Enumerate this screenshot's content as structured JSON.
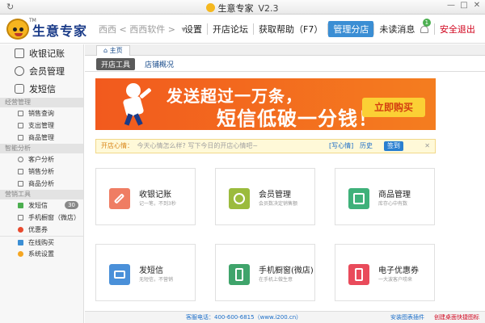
{
  "window": {
    "title": "生意专家",
    "version": "V2.3",
    "refresh_icon": "↻",
    "minimize": "—",
    "maximize": "□",
    "close": "✕"
  },
  "header": {
    "logo_text": "生意专家",
    "logo_tm": "TM",
    "company": "西西 < 西西软件 >",
    "company_arrow": "▾",
    "nav": [
      "设置",
      "开店论坛",
      "获取帮助（F7）",
      "管理分店",
      "未读消息",
      "安全退出"
    ],
    "unread_count": "1"
  },
  "sidebar": {
    "main_items": [
      "收银记账",
      "会员管理",
      "发短信"
    ],
    "sections": [
      {
        "title": "经营管理",
        "items": [
          "销售查询",
          "支出管理",
          "商品管理"
        ]
      },
      {
        "title": "智能分析",
        "items": [
          "客户分析",
          "销售分析",
          "商品分析"
        ]
      },
      {
        "title": "营销工具",
        "items": [
          "发短信",
          "手机橱窗（微店）",
          "优惠券"
        ]
      }
    ],
    "sms_count": "30",
    "bottom_items": [
      "在线购买",
      "系统设置"
    ]
  },
  "tabs": {
    "home": "主页",
    "sub": [
      "开店工具",
      "店铺概况"
    ]
  },
  "banner": {
    "line1": "发送超过一万条，",
    "line2": "短信低破一分钱！",
    "button": "立即购买"
  },
  "notice": {
    "label": "开店心情：",
    "placeholder": "今天心情怎么样? 写下今日的开店心情吧~",
    "write": "[写心情]",
    "history": "历史",
    "signin": "签到",
    "close": "✕"
  },
  "cards": [
    {
      "title": "收银记账",
      "subtitle": "记一笔，不到3秒",
      "icon": "pencil-icon",
      "color": "#ef7d63"
    },
    {
      "title": "会员管理",
      "subtitle": "会员数决定销售额",
      "icon": "members-icon",
      "color": "#9bbb3d"
    },
    {
      "title": "商品管理",
      "subtitle": "库存心中有数",
      "icon": "goods-icon",
      "color": "#3fb17a"
    },
    {
      "title": "发短信",
      "subtitle": "无短信，不营销",
      "icon": "message-icon",
      "color": "#4a90d9"
    },
    {
      "title": "手机橱窗(微店)",
      "subtitle": "在手机上做生意",
      "icon": "phone-icon",
      "color": "#3fa46b"
    },
    {
      "title": "电子优惠券",
      "subtitle": "一大波客户唠来",
      "icon": "coupon-icon",
      "color": "#e94b5b"
    }
  ],
  "footer": {
    "hotline": "客服电话：400-600-6815（www.i200.cn）",
    "plugin": "安装图表插件",
    "shortcut": "创建桌面快捷图标"
  }
}
